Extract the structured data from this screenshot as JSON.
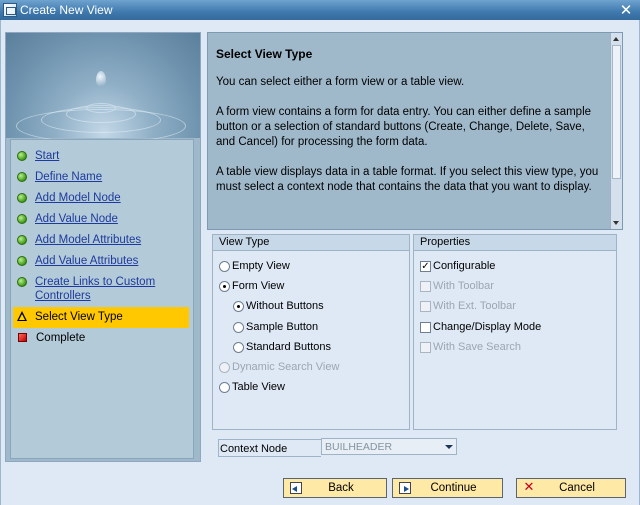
{
  "window": {
    "title": "Create New View",
    "close_glyph": "✕"
  },
  "roadmap": {
    "steps": [
      {
        "label": "Start",
        "state": "done"
      },
      {
        "label": "Define Name",
        "state": "done"
      },
      {
        "label": "Add Model Node",
        "state": "done"
      },
      {
        "label": "Add Value Node",
        "state": "done"
      },
      {
        "label": "Add Model Attributes",
        "state": "done"
      },
      {
        "label": "Add Value Attributes",
        "state": "done"
      },
      {
        "label": "Create Links to Custom Controllers",
        "state": "done"
      },
      {
        "label": "Select View Type",
        "state": "current"
      },
      {
        "label": "Complete",
        "state": "pending"
      }
    ]
  },
  "info": {
    "title": "Select View Type",
    "paragraphs": [
      "You can select either a form view or a table view.",
      "A form view contains a form for data entry. You can either define a sample button or a selection of standard buttons (Create, Change, Delete, Save, and Cancel) for processing the form data.",
      "A table view displays data in a table format. If you select this view type, you must select a context node that contains the data that you want to display."
    ]
  },
  "view_type": {
    "header": "View Type",
    "options": {
      "empty_view": "Empty View",
      "form_view": "Form View",
      "without_buttons": "Without Buttons",
      "sample_button": "Sample Button",
      "standard_buttons": "Standard Buttons",
      "dynamic_search_view": "Dynamic Search View",
      "table_view": "Table View"
    },
    "selected": "Form View",
    "selected_sub": "Without Buttons"
  },
  "properties": {
    "header": "Properties",
    "items": {
      "configurable": "Configurable",
      "with_toolbar": "With Toolbar",
      "with_ext_toolbar": "With Ext. Toolbar",
      "change_display_mode": "Change/Display Mode",
      "with_save_search": "With Save Search"
    },
    "check_glyph": "✓"
  },
  "context_node": {
    "label": "Context Node",
    "value": "BUILHEADER"
  },
  "buttons": {
    "back": "Back",
    "continue": "Continue",
    "cancel": "Cancel",
    "cancel_glyph": "✕"
  },
  "colors": {
    "title_bar": "#3f79ad",
    "current_step": "#ffc800",
    "button_bg": "#ffe9a6"
  }
}
